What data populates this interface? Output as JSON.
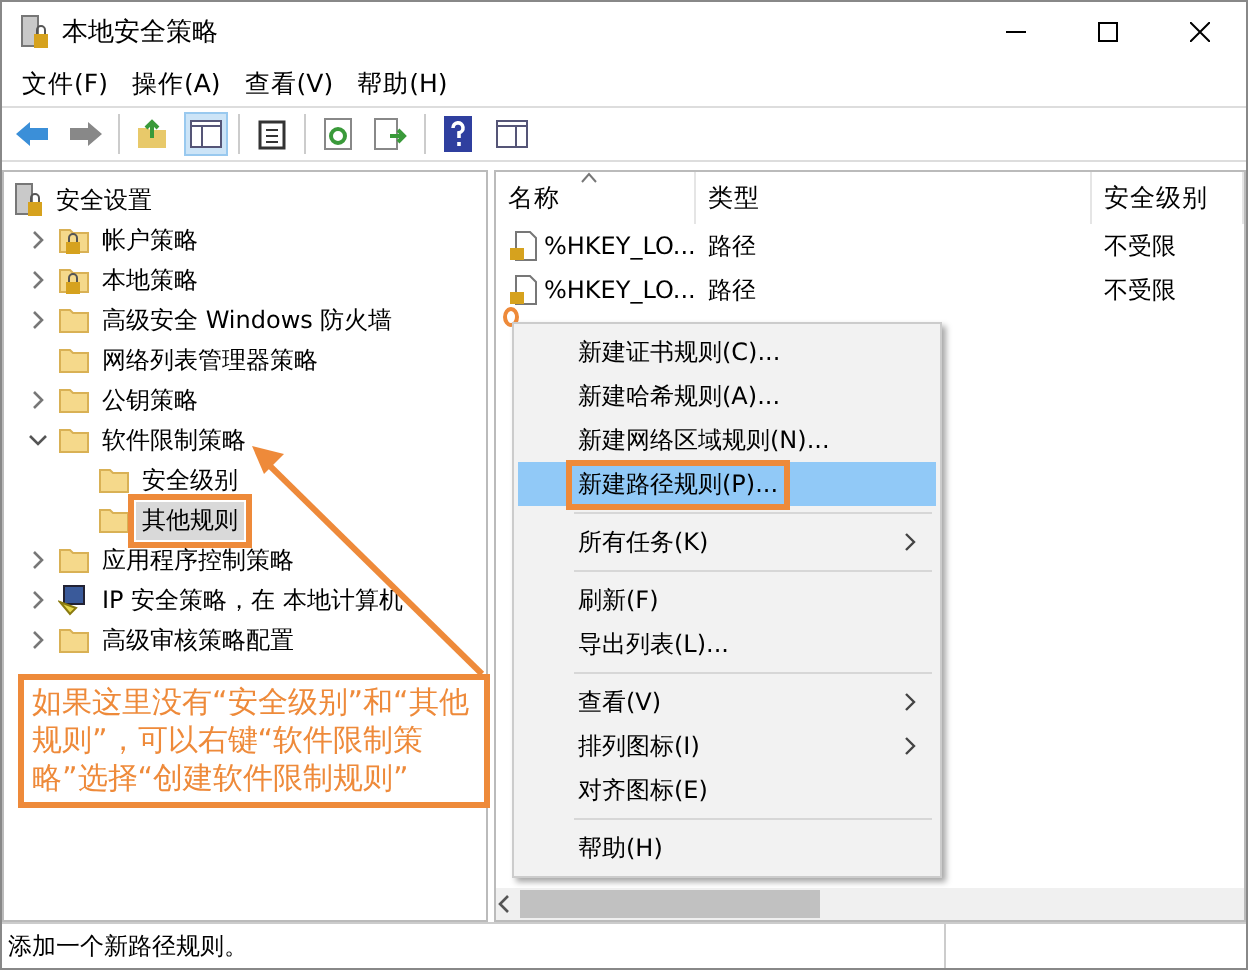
{
  "window": {
    "title": "本地安全策略"
  },
  "menu_bar": [
    "文件(F)",
    "操作(A)",
    "查看(V)",
    "帮助(H)"
  ],
  "tree": {
    "label": "安全设置",
    "kind": "server",
    "selected": false,
    "highlighted": false,
    "children": [
      {
        "label": "帐户策略",
        "kind": "locked-folder",
        "expanded": false,
        "selected": false,
        "highlighted": false
      },
      {
        "label": "本地策略",
        "kind": "locked-folder",
        "expanded": false,
        "selected": false,
        "highlighted": false
      },
      {
        "label": "高级安全 Windows 防火墙",
        "kind": "folder",
        "expanded": false,
        "selected": false,
        "highlighted": false
      },
      {
        "label": "网络列表管理器策略",
        "kind": "folder",
        "selected": false,
        "highlighted": false
      },
      {
        "label": "公钥策略",
        "kind": "folder",
        "expanded": false,
        "selected": false,
        "highlighted": false
      },
      {
        "label": "软件限制策略",
        "kind": "folder",
        "expanded": true,
        "selected": false,
        "highlighted": false,
        "children": [
          {
            "label": "安全级别",
            "kind": "folder",
            "selected": false,
            "highlighted": false
          },
          {
            "label": "其他规则",
            "kind": "folder",
            "selected": true,
            "highlighted": true
          }
        ]
      },
      {
        "label": "应用程序控制策略",
        "kind": "folder",
        "expanded": false,
        "selected": false,
        "highlighted": false
      },
      {
        "label": "IP 安全策略，在 本地计算机",
        "kind": "network-policy",
        "expanded": false,
        "selected": false,
        "highlighted": false
      },
      {
        "label": "高级审核策略配置",
        "kind": "folder",
        "expanded": false,
        "selected": false,
        "highlighted": false
      }
    ]
  },
  "list": {
    "columns": [
      {
        "label": "名称",
        "sorted": true
      },
      {
        "label": "类型",
        "sorted": false
      },
      {
        "label": "安全级别",
        "sorted": false
      }
    ],
    "rows": [
      [
        "%HKEY_LO...",
        "路径",
        "不受限"
      ],
      [
        "%HKEY_LO...",
        "路径",
        "不受限"
      ]
    ]
  },
  "context_menu": {
    "items": [
      {
        "kind": "item",
        "label": "新建证书规则(C)...",
        "submenu": false,
        "selected": false,
        "highlighted": false
      },
      {
        "kind": "item",
        "label": "新建哈希规则(A)...",
        "submenu": false,
        "selected": false,
        "highlighted": false
      },
      {
        "kind": "item",
        "label": "新建网络区域规则(N)...",
        "submenu": false,
        "selected": false,
        "highlighted": false
      },
      {
        "kind": "item",
        "label": "新建路径规则(P)...",
        "submenu": false,
        "selected": true,
        "highlighted": true
      },
      {
        "kind": "separator"
      },
      {
        "kind": "item",
        "label": "所有任务(K)",
        "submenu": true,
        "selected": false,
        "highlighted": false
      },
      {
        "kind": "separator"
      },
      {
        "kind": "item",
        "label": "刷新(F)",
        "submenu": false,
        "selected": false,
        "highlighted": false
      },
      {
        "kind": "item",
        "label": "导出列表(L)...",
        "submenu": false,
        "selected": false,
        "highlighted": false
      },
      {
        "kind": "separator"
      },
      {
        "kind": "item",
        "label": "查看(V)",
        "submenu": true,
        "selected": false,
        "highlighted": false
      },
      {
        "kind": "item",
        "label": "排列图标(I)",
        "submenu": true,
        "selected": false,
        "highlighted": false
      },
      {
        "kind": "item",
        "label": "对齐图标(E)",
        "submenu": false,
        "selected": false,
        "highlighted": false
      },
      {
        "kind": "separator"
      },
      {
        "kind": "item",
        "label": "帮助(H)",
        "submenu": false,
        "selected": false,
        "highlighted": false
      }
    ]
  },
  "annotation": {
    "text": "如果这里没有“安全级别”和“其他规则”，可以右键“软件限制策略”选择“创建软件限制规则”"
  },
  "status_bar": {
    "text": "添加一个新路径规则。"
  }
}
